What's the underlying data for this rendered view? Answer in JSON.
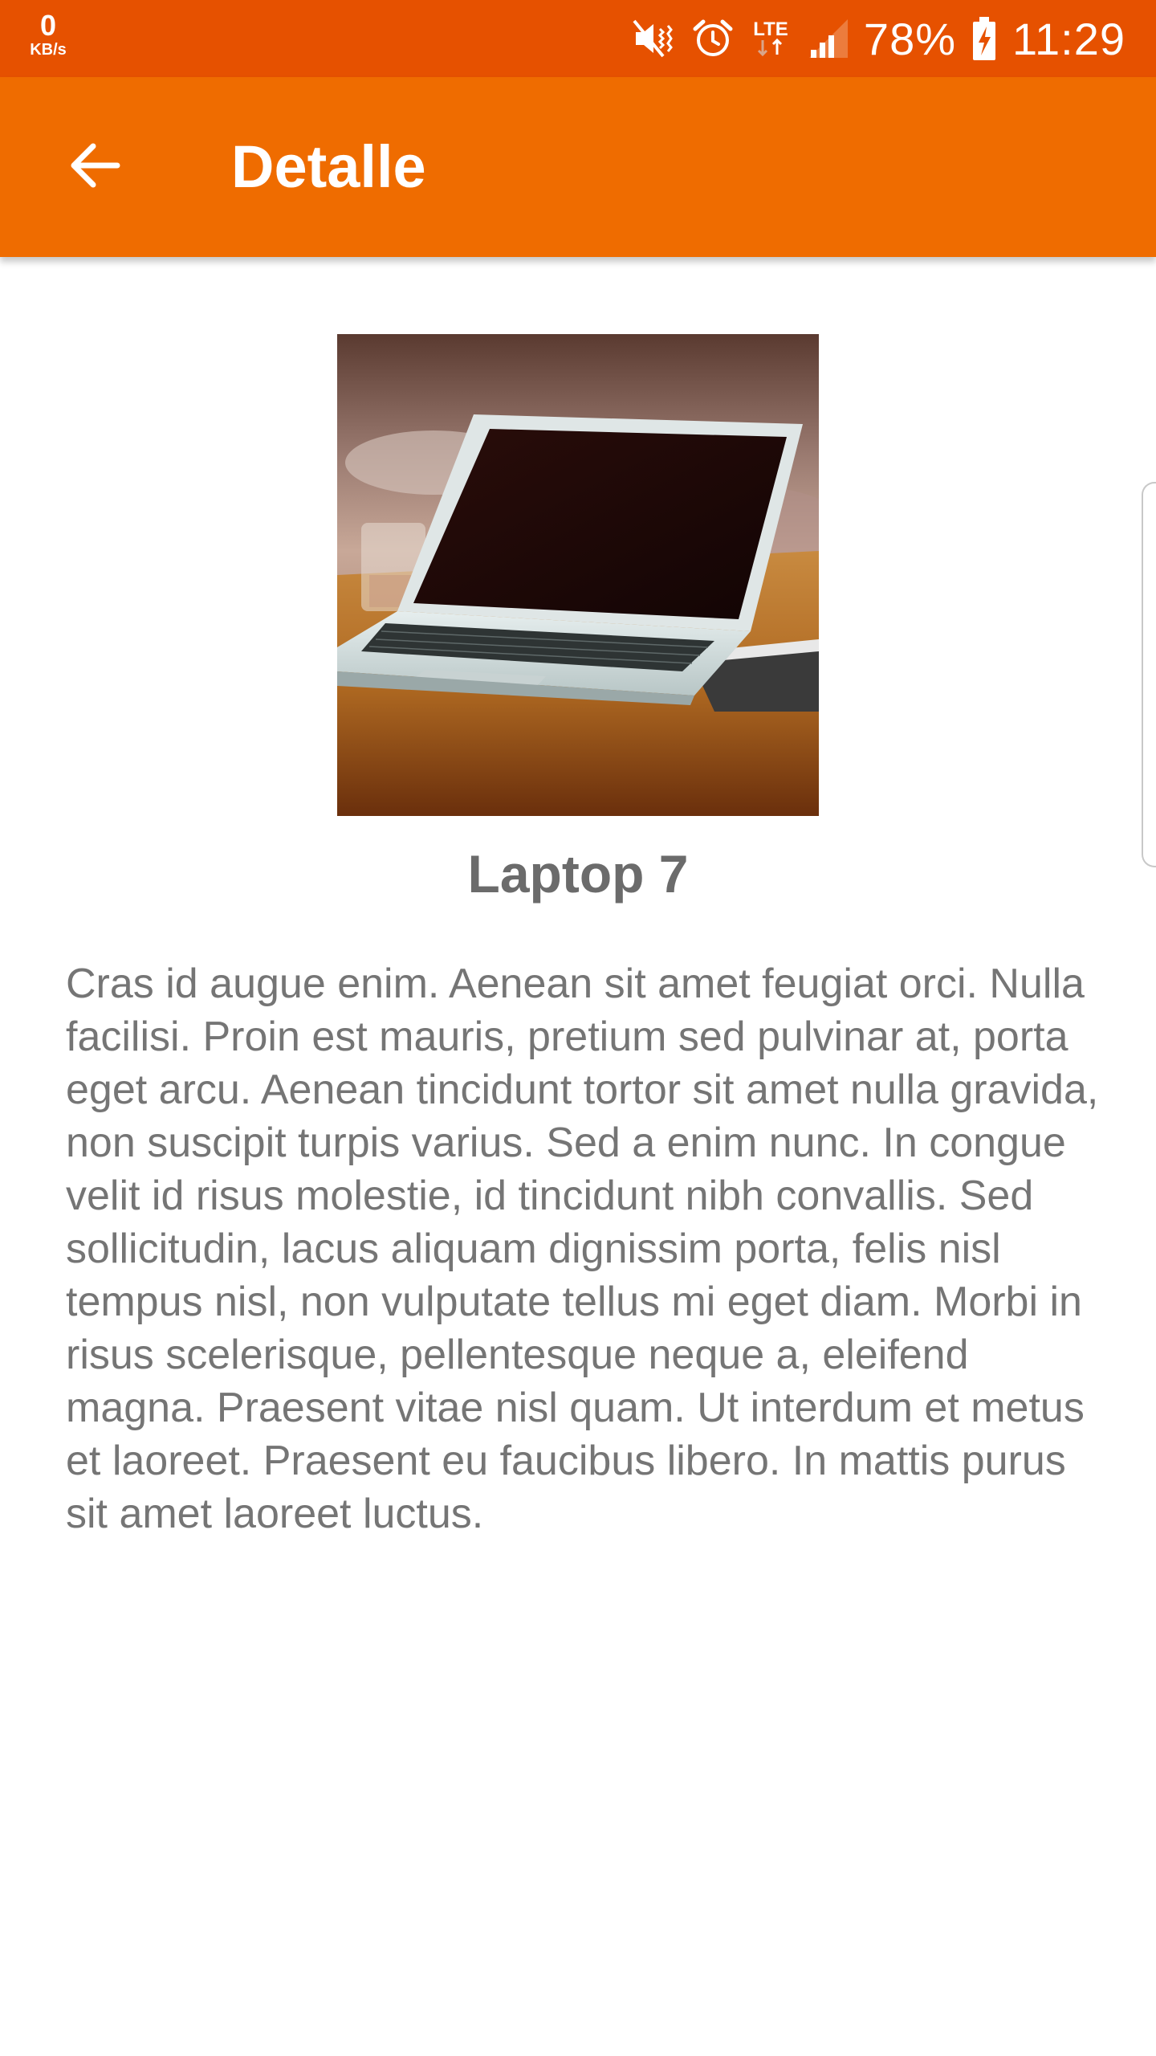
{
  "status_bar": {
    "net_speed": "0",
    "net_unit": "KB/s",
    "network_label": "LTE",
    "battery": "78%",
    "time": "11:29"
  },
  "app_bar": {
    "title": "Detalle",
    "back_icon": "arrow-back-icon",
    "color": "#ef6c00"
  },
  "product": {
    "image": "laptop-on-wooden-table",
    "title": "Laptop 7",
    "description": "Cras id augue enim. Aenean sit amet feugiat orci. Nulla facilisi. Proin est mauris, pretium sed pulvinar at, porta eget arcu. Aenean tincidunt tortor sit amet nulla gravida, non suscipit turpis varius. Sed a enim nunc. In congue velit id risus molestie, id tincidunt nibh convallis. Sed sollicitudin, lacus aliquam dignissim porta, felis nisl tempus nisl, non vulputate tellus mi eget diam. Morbi in risus scelerisque, pellentesque neque a, eleifend magna. Praesent vitae nisl quam. Ut interdum et metus et laoreet. Praesent eu faucibus libero. In mattis purus sit amet laoreet luctus."
  },
  "colors": {
    "status_bar": "#e65100",
    "app_bar": "#ef6c00",
    "text": "#757575"
  }
}
